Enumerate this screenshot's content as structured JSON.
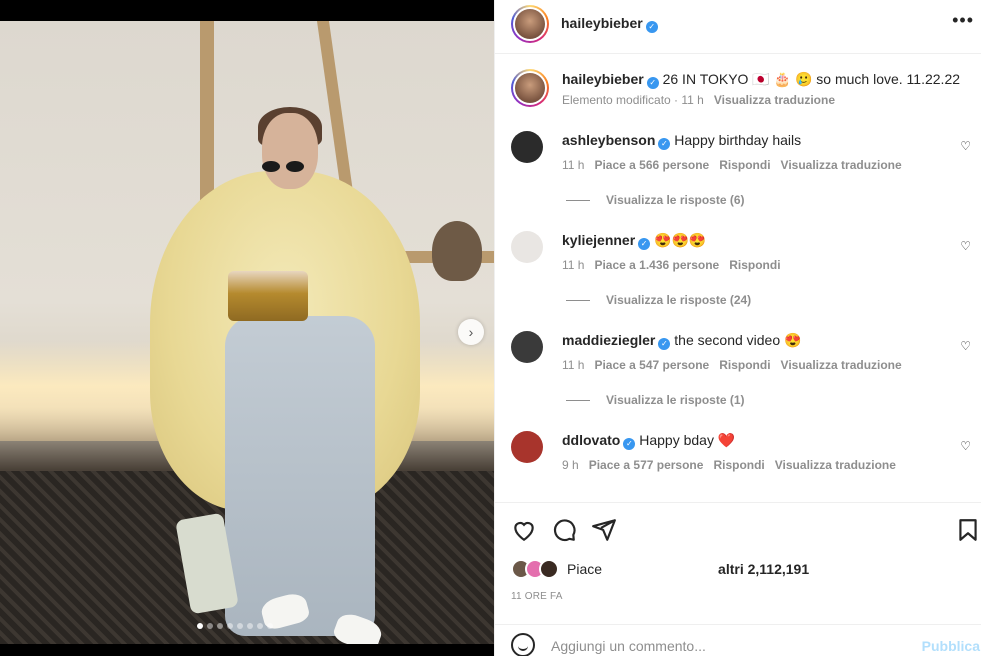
{
  "post": {
    "author": "haileybieber",
    "caption_text": "26 IN TOKYO 🇯🇵 🎂 🥲  so much love. 11.22.22",
    "caption_meta_edited": "Elemento modificato · 11 h",
    "caption_translate": "Visualizza traduzione",
    "more_icon": "•••",
    "next_icon": "›"
  },
  "comments": [
    {
      "username": "ashleybenson",
      "text": "Happy birthday hails",
      "time": "11 h",
      "likes": "Piace a 566 persone",
      "reply": "Rispondi",
      "translate": "Visualizza traduzione",
      "replies": "Visualizza le risposte (6)",
      "avatar_color": "#2b2b2b"
    },
    {
      "username": "kyliejenner",
      "text": "😍😍😍",
      "time": "11 h",
      "likes": "Piace a 1.436 persone",
      "reply": "Rispondi",
      "translate": "",
      "replies": "Visualizza le risposte (24)",
      "avatar_color": "#e9e6e3"
    },
    {
      "username": "maddieziegler",
      "text": "the second video 😍",
      "time": "11 h",
      "likes": "Piace a 547 persone",
      "reply": "Rispondi",
      "translate": "Visualizza traduzione",
      "replies": "Visualizza le risposte (1)",
      "avatar_color": "#3a3a3a"
    },
    {
      "username": "ddlovato",
      "text": "Happy bday ❤️",
      "time": "9 h",
      "likes": "Piace a 577 persone",
      "reply": "Rispondi",
      "translate": "Visualizza traduzione",
      "replies": "",
      "avatar_color": "#a8342c"
    }
  ],
  "likes": {
    "prefix": "Piace",
    "suffix": "altri 2,112,191",
    "time_ago": "11 ORE FA"
  },
  "add_comment": {
    "placeholder": "Aggiungi un commento...",
    "publish": "Pubblica"
  },
  "carousel": {
    "dots": 8,
    "active": 0
  }
}
